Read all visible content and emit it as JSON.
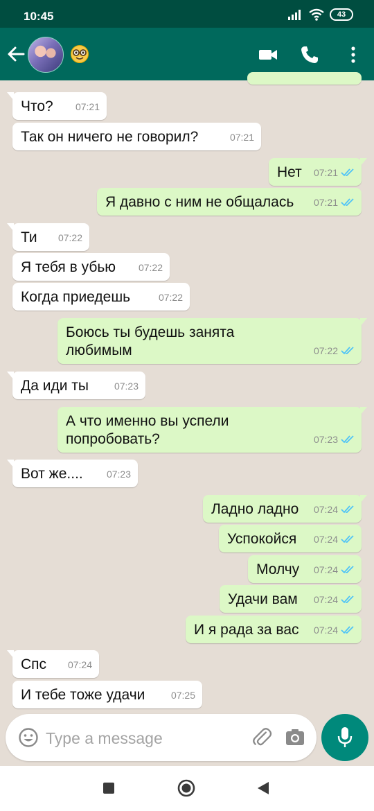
{
  "status_bar": {
    "time": "10:45",
    "battery": "43"
  },
  "header": {
    "back_icon": "arrow-left-icon",
    "contact_emoji": "nerd-face-emoji",
    "video_icon": "video-camera-icon",
    "phone_icon": "phone-icon",
    "menu_icon": "more-vertical-icon"
  },
  "messages": [
    {
      "dir": "in",
      "text": "Что?",
      "time": "07:21"
    },
    {
      "dir": "in",
      "text": "Так он ничего не говорил?",
      "time": "07:21"
    },
    {
      "dir": "out",
      "text": "Нет",
      "time": "07:21"
    },
    {
      "dir": "out",
      "text": "Я давно с ним не общалась",
      "time": "07:21"
    },
    {
      "dir": "in",
      "text": "Ти",
      "time": "07:22"
    },
    {
      "dir": "in",
      "text": "Я тебя в убью",
      "time": "07:22"
    },
    {
      "dir": "in",
      "text": "Когда приедешь",
      "time": "07:22"
    },
    {
      "dir": "out",
      "text": "Боюсь ты будешь занята любимым",
      "time": "07:22"
    },
    {
      "dir": "in",
      "text": "Да иди ты",
      "time": "07:23"
    },
    {
      "dir": "out",
      "text": "А что именно вы успели попробовать?",
      "time": "07:23"
    },
    {
      "dir": "in",
      "text": "Вот же....",
      "time": "07:23"
    },
    {
      "dir": "out",
      "text": "Ладно ладно",
      "time": "07:24"
    },
    {
      "dir": "out",
      "text": "Успокойся",
      "time": "07:24"
    },
    {
      "dir": "out",
      "text": "Молчу",
      "time": "07:24"
    },
    {
      "dir": "out",
      "text": "Удачи вам",
      "time": "07:24"
    },
    {
      "dir": "out",
      "text": "И я рада за вас",
      "time": "07:24"
    },
    {
      "dir": "in",
      "text": "Спс",
      "time": "07:24"
    },
    {
      "dir": "in",
      "text": "И тебе тоже удачи",
      "time": "07:25"
    }
  ],
  "composer": {
    "placeholder": "Type a message"
  },
  "colors": {
    "header": "#00695c",
    "status_bar": "#004d40",
    "outgoing_bubble": "#dcf8c6",
    "incoming_bubble": "#ffffff",
    "chat_background": "#e5ddd5",
    "read_ticks": "#4fc3f7",
    "mic_button": "#00897b"
  }
}
